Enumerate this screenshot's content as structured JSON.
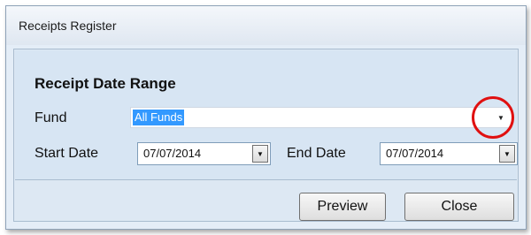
{
  "window": {
    "title": "Receipts Register"
  },
  "group": {
    "heading": "Receipt Date Range"
  },
  "fund": {
    "label": "Fund",
    "value": "All Funds"
  },
  "start_date": {
    "label": "Start Date",
    "value": "07/07/2014"
  },
  "end_date": {
    "label": "End Date",
    "value": "07/07/2014"
  },
  "buttons": {
    "preview": "Preview",
    "close": "Close"
  },
  "icons": {
    "dropdown": "chevron-down-icon"
  },
  "colors": {
    "selection": "#3399ff",
    "highlight_circle": "#e01010"
  }
}
